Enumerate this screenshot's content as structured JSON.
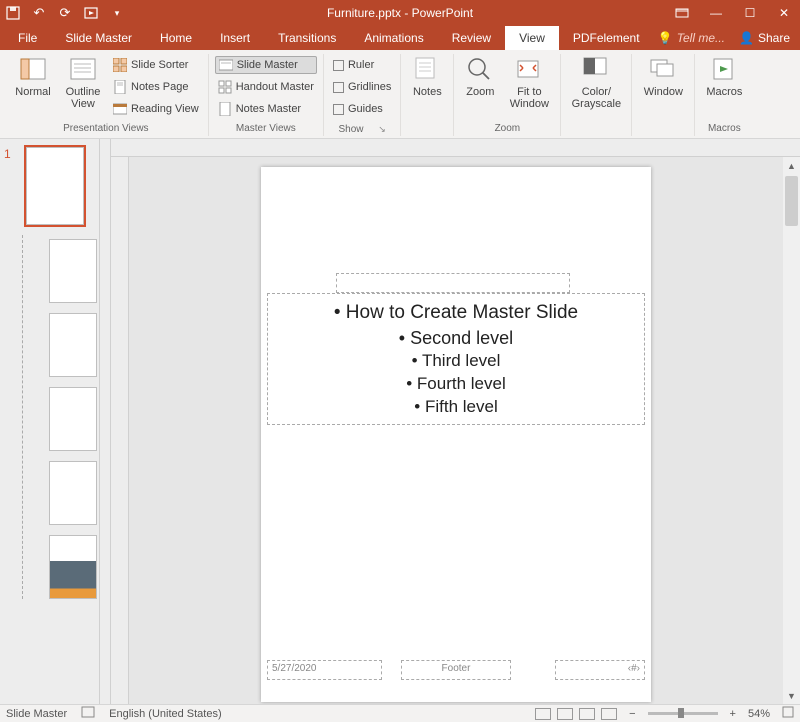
{
  "title": {
    "filename": "Furniture.pptx",
    "app": "PowerPoint"
  },
  "tabs": {
    "file": "File",
    "slide_master": "Slide Master",
    "home": "Home",
    "insert": "Insert",
    "transitions": "Transitions",
    "animations": "Animations",
    "review": "Review",
    "view": "View",
    "pdfelement": "PDFelement",
    "tell_me": "Tell me...",
    "share": "Share"
  },
  "ribbon": {
    "presentation_views": {
      "label": "Presentation Views",
      "normal": "Normal",
      "outline": "Outline View",
      "slide_sorter": "Slide Sorter",
      "notes_page": "Notes Page",
      "reading_view": "Reading View"
    },
    "master_views": {
      "label": "Master Views",
      "slide_master": "Slide Master",
      "handout_master": "Handout Master",
      "notes_master": "Notes Master"
    },
    "show": {
      "label": "Show",
      "ruler": "Ruler",
      "gridlines": "Gridlines",
      "guides": "Guides"
    },
    "notes": "Notes",
    "zoom_group": {
      "label": "Zoom",
      "zoom": "Zoom",
      "fit": "Fit to Window"
    },
    "color": {
      "label": "Color/ Grayscale",
      "btn": "Color/ Grayscale"
    },
    "window": {
      "label": "Window",
      "btn": "Window"
    },
    "macros": {
      "label": "Macros",
      "btn": "Macros"
    }
  },
  "thumbnails": {
    "master_index": "1"
  },
  "slide": {
    "levels": {
      "l1": "How to Create Master Slide",
      "l2": "Second level",
      "l3": "Third level",
      "l4": "Fourth level",
      "l5": "Fifth level"
    },
    "date": "5/27/2020",
    "footer": "Footer",
    "number": "‹#›"
  },
  "status": {
    "left": "Slide Master",
    "lang": "English (United States)",
    "zoom": "54%"
  }
}
